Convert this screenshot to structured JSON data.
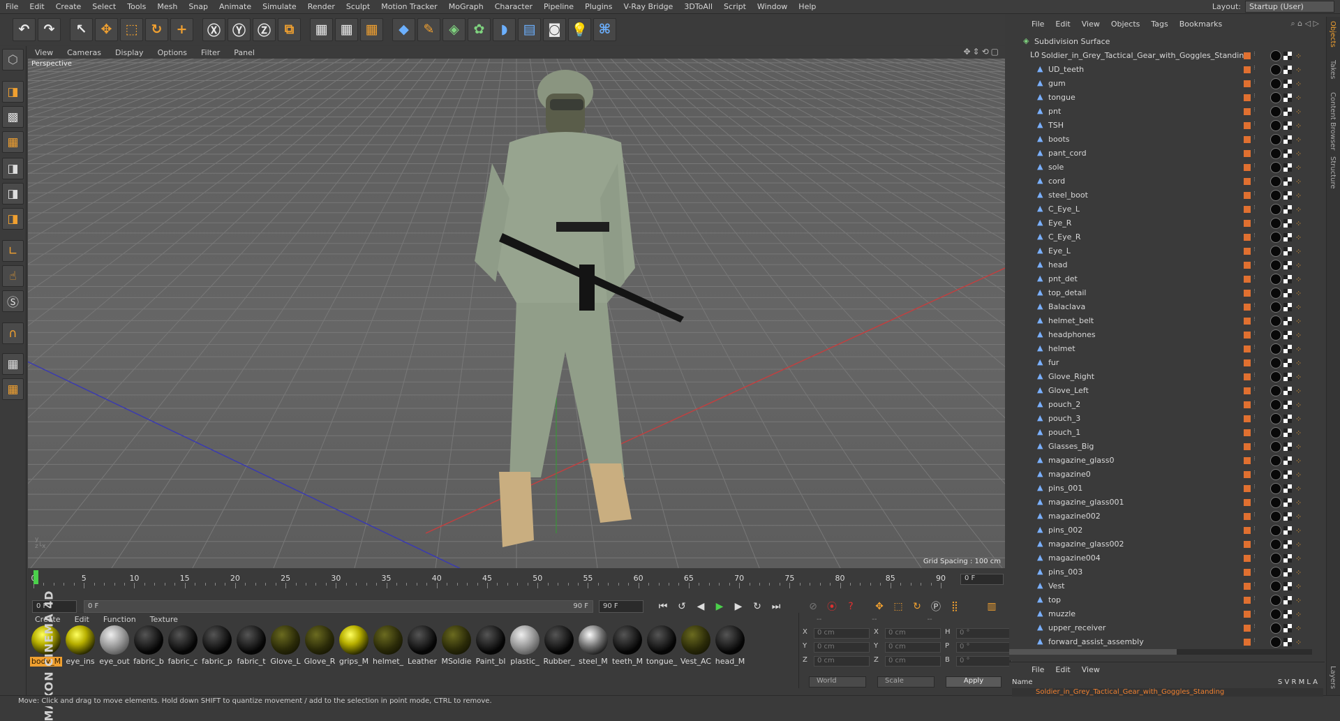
{
  "menu": [
    "File",
    "Edit",
    "Create",
    "Select",
    "Tools",
    "Mesh",
    "Snap",
    "Animate",
    "Simulate",
    "Render",
    "Sculpt",
    "Motion Tracker",
    "MoGraph",
    "Character",
    "Pipeline",
    "Plugins",
    "V-Ray Bridge",
    "3DToAll",
    "Script",
    "Window",
    "Help"
  ],
  "layout": {
    "label": "Layout:",
    "value": "Startup (User)"
  },
  "viewport": {
    "menu": [
      "View",
      "Cameras",
      "Display",
      "Options",
      "Filter",
      "Panel"
    ],
    "label": "Perspective",
    "grid_spacing": "Grid Spacing : 100 cm"
  },
  "timeline": {
    "ticks": [
      "0",
      "5",
      "10",
      "15",
      "20",
      "25",
      "30",
      "35",
      "40",
      "45",
      "50",
      "55",
      "60",
      "65",
      "70",
      "75",
      "80",
      "85",
      "90"
    ],
    "frame_end_label": "0 F",
    "field_start": "0 F",
    "range_start": "0 F",
    "range_end": "90 F",
    "field_end": "90 F"
  },
  "materials": {
    "menu": [
      "Create",
      "Edit",
      "Function",
      "Texture"
    ],
    "items": [
      {
        "label": "body_M",
        "style": "y",
        "selected": true
      },
      {
        "label": "eye_ins",
        "style": "y"
      },
      {
        "label": "eye_out",
        "style": "w"
      },
      {
        "label": "fabric_b",
        "style": "k"
      },
      {
        "label": "fabric_c",
        "style": "k"
      },
      {
        "label": "fabric_p",
        "style": "k"
      },
      {
        "label": "fabric_t",
        "style": "k"
      },
      {
        "label": "Glove_L",
        "style": "d"
      },
      {
        "label": "Glove_R",
        "style": "d"
      },
      {
        "label": "grips_M",
        "style": "y"
      },
      {
        "label": "helmet_",
        "style": "d"
      },
      {
        "label": "Leather",
        "style": "k"
      },
      {
        "label": "MSoldie",
        "style": "d"
      },
      {
        "label": "Paint_bl",
        "style": "k"
      },
      {
        "label": "plastic_",
        "style": "w"
      },
      {
        "label": "Rubber_",
        "style": "k"
      },
      {
        "label": "steel_M",
        "style": "m"
      },
      {
        "label": "teeth_M",
        "style": "k"
      },
      {
        "label": "tongue_",
        "style": "k"
      },
      {
        "label": "Vest_AC",
        "style": "d"
      },
      {
        "label": "head_M",
        "style": "k"
      }
    ]
  },
  "coords": {
    "header": [
      "--",
      "--",
      "--"
    ],
    "rows": [
      {
        "a": "X",
        "av": "0 cm",
        "b": "X",
        "bv": "0 cm",
        "c": "H",
        "cv": "0 °"
      },
      {
        "a": "Y",
        "av": "0 cm",
        "b": "Y",
        "bv": "0 cm",
        "c": "P",
        "cv": "0 °"
      },
      {
        "a": "Z",
        "av": "0 cm",
        "b": "Z",
        "bv": "0 cm",
        "c": "B",
        "cv": "0 °"
      }
    ],
    "mode1": "World",
    "mode2": "Scale",
    "apply": "Apply"
  },
  "objects": {
    "menu": [
      "File",
      "Edit",
      "View",
      "Objects",
      "Tags",
      "Bookmarks"
    ],
    "root": "Subdivision Surface",
    "group": "Soldier_in_Grey_Tactical_Gear_with_Goggles_Standing",
    "items": [
      "UD_teeth",
      "gum",
      "tongue",
      "pnt",
      "TSH",
      "boots",
      "pant_cord",
      "sole",
      "cord",
      "steel_boot",
      "C_Eye_L",
      "Eye_R",
      "C_Eye_R",
      "Eye_L",
      "head",
      "pnt_det",
      "top_detail",
      "Balaclava",
      "helmet_belt",
      "headphones",
      "helmet",
      "fur",
      "Glove_Right",
      "Glove_Left",
      "pouch_2",
      "pouch_3",
      "pouch_1",
      "Glasses_Big",
      "magazine_glass0",
      "magazine0",
      "pins_001",
      "magazine_glass001",
      "magazine002",
      "pins_002",
      "magazine_glass002",
      "magazine004",
      "pins_003",
      "Vest",
      "top",
      "muzzle",
      "upper_receiver",
      "forward_assist_assembly"
    ]
  },
  "layers": {
    "menu": [
      "File",
      "Edit",
      "View"
    ],
    "header_name": "Name",
    "header_cols": "S V R M L A",
    "row": "Soldier_in_Grey_Tactical_Gear_with_Goggles_Standing"
  },
  "side_tabs": [
    "Objects",
    "Takes",
    "Content Browser",
    "Structure",
    "Layers"
  ],
  "status": "Move: Click and drag to move elements. Hold down SHIFT to quantize movement / add to the selection in point mode, CTRL to remove.",
  "logo": "MAXON CINEMA 4D",
  "colors": {
    "accent": "#f0a030",
    "playhead": "#4bd04b"
  }
}
